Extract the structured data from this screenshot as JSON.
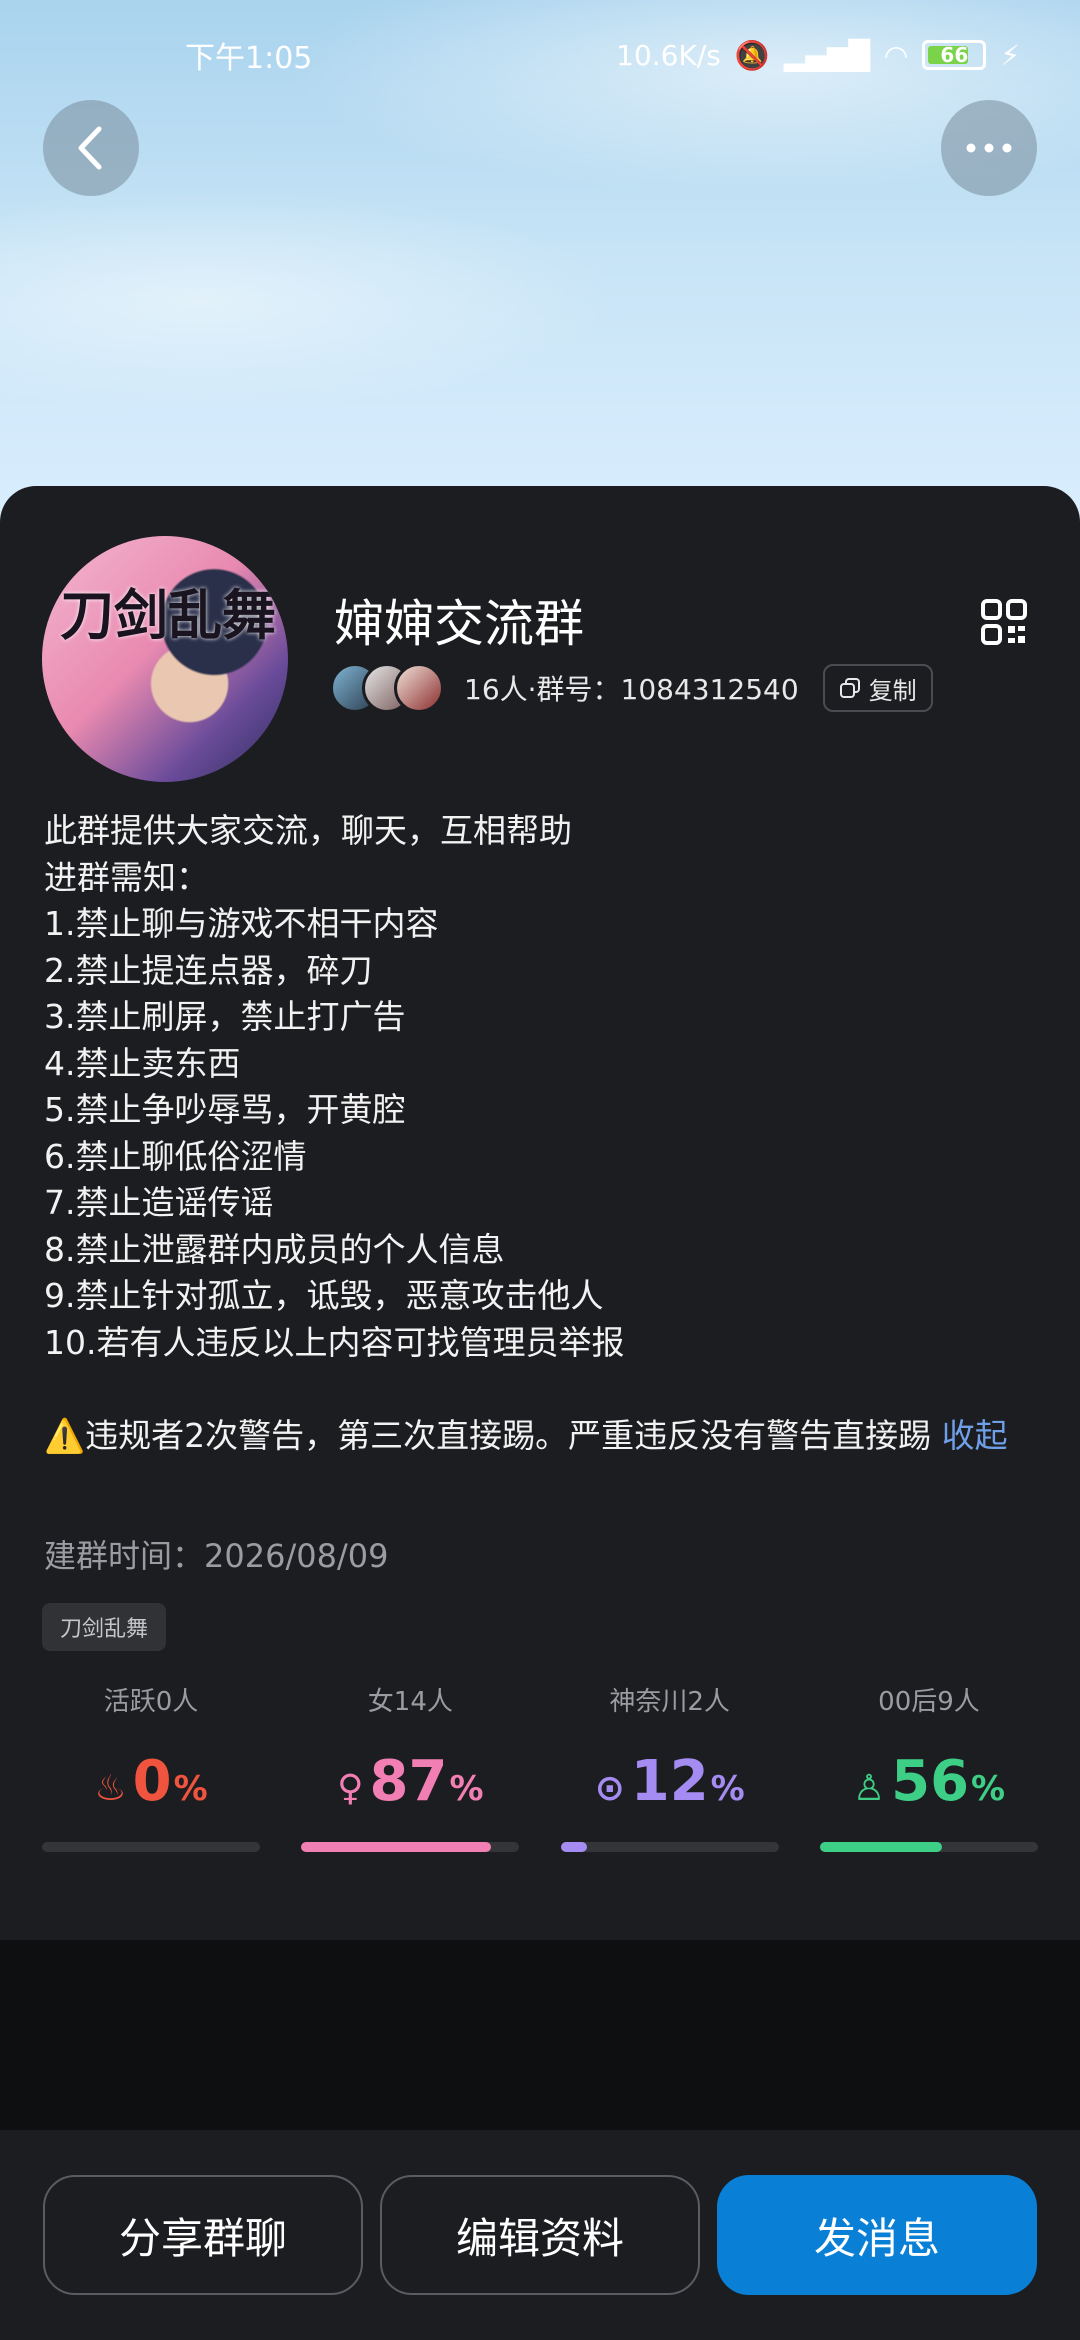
{
  "status_bar": {
    "time": "下午1:05",
    "net_speed": "10.6K/s",
    "battery": "66"
  },
  "header": {
    "back_icon": "back-icon",
    "more_icon": "more-icon"
  },
  "group": {
    "name": "婶婶交流群",
    "members_text": "16人·群号：1084312540",
    "copy_label": "复制",
    "description": "此群提供大家交流，聊天，互相帮助\n进群需知：\n1.禁止聊与游戏不相干内容\n2.禁止提连点器，碎刀\n3.禁止刷屏，禁止打广告\n4.禁止卖东西\n5.禁止争吵辱骂，开黄腔\n6.禁止聊低俗涩情\n7.禁止造谣传谣\n8.禁止泄露群内成员的个人信息\n9.禁止针对孤立，诋毁，恶意攻击他人\n10.若有人违反以上内容可找管理员举报\n\n⚠️违规者2次警告，第三次直接踢。严重违反没有警告直接踢 ",
    "collapse_label": "收起",
    "create_time": "建群时间：2026/08/09",
    "tag": "刀剑乱舞",
    "avatar_text": "刀剑乱舞"
  },
  "stats": [
    {
      "label": "活跃0人",
      "value": "0",
      "pct": "%",
      "fraction": 0.0,
      "color": "#f0543e",
      "icon": "flame-icon",
      "glyph": "♨"
    },
    {
      "label": "女14人",
      "value": "87",
      "pct": "%",
      "fraction": 0.87,
      "color": "#f27fb3",
      "icon": "female-icon",
      "glyph": "♀"
    },
    {
      "label": "神奈川2人",
      "value": "12",
      "pct": "%",
      "fraction": 0.12,
      "color": "#a58cf2",
      "icon": "location-icon",
      "glyph": "⊙"
    },
    {
      "label": "00后9人",
      "value": "56",
      "pct": "%",
      "fraction": 0.56,
      "color": "#3ecf86",
      "icon": "person-icon",
      "glyph": "♙"
    }
  ],
  "actions": {
    "share": "分享群聊",
    "edit": "编辑资料",
    "send": "发消息"
  }
}
